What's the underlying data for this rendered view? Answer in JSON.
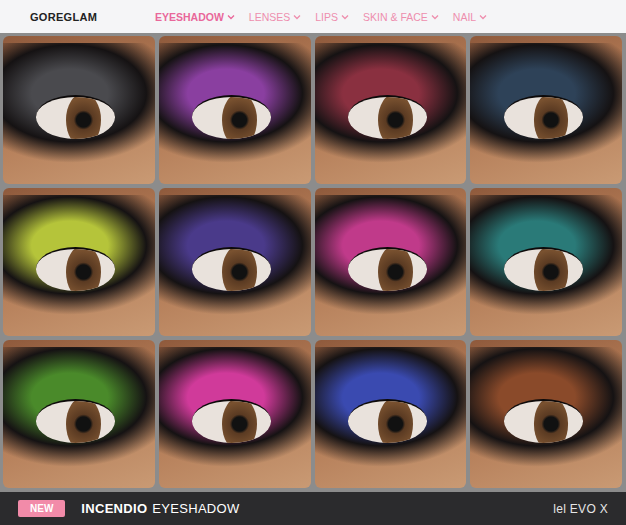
{
  "logo": "GOREGLAM",
  "nav": [
    {
      "label": "EYESHADOW",
      "selected": true
    },
    {
      "label": "LENSES",
      "selected": false
    },
    {
      "label": "LIPS",
      "selected": false
    },
    {
      "label": "SKIN & FACE",
      "selected": false
    },
    {
      "label": "NAIL",
      "selected": false
    }
  ],
  "swatches": [
    {
      "color": "#4a4a4e"
    },
    {
      "color": "#8a3fa0"
    },
    {
      "color": "#8a3040"
    },
    {
      "color": "#2e4258"
    },
    {
      "color": "#b5c43a"
    },
    {
      "color": "#4a3a8a"
    },
    {
      "color": "#c03a8a"
    },
    {
      "color": "#2a7a78"
    },
    {
      "color": "#4a8a2a"
    },
    {
      "color": "#d03a9a"
    },
    {
      "color": "#3a4ab0"
    },
    {
      "color": "#8a4a2a"
    }
  ],
  "banner": {
    "badge": "NEW",
    "name": "INCENDIO",
    "type": "EYESHADOW",
    "compatibility": "lel EVO X"
  }
}
